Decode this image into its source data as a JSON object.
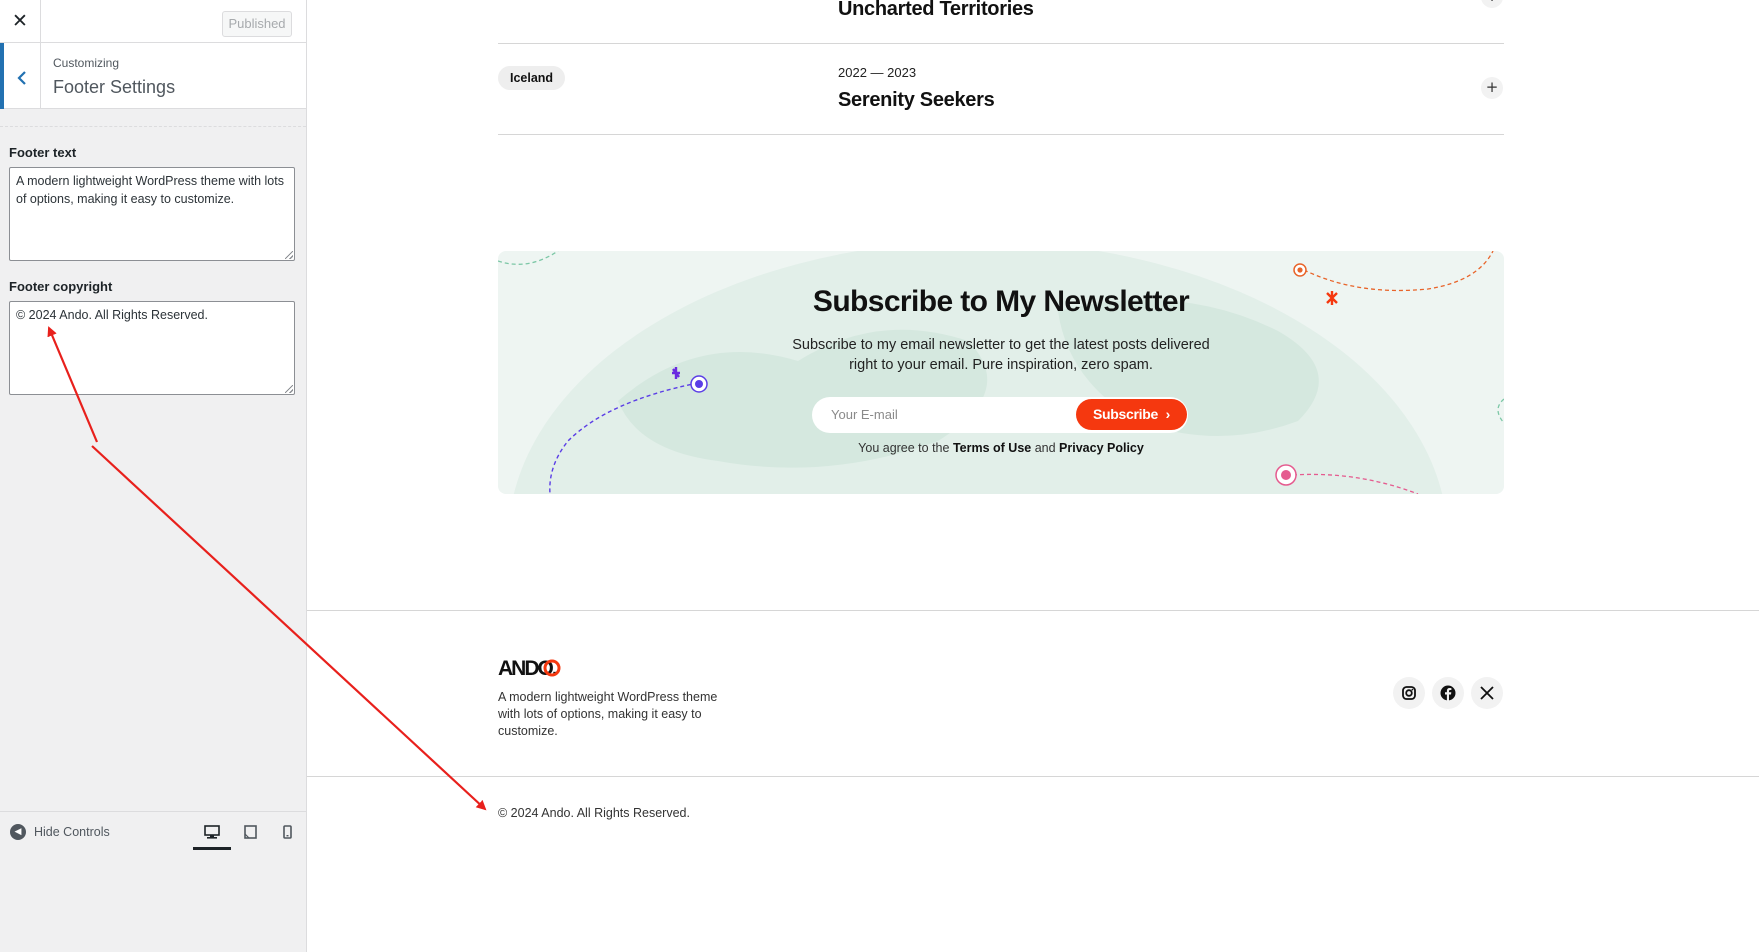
{
  "sidebar": {
    "close_symbol": "✕",
    "publish_label": "Published",
    "back_symbol": "‹",
    "customizing_label": "Customizing",
    "section_title": "Footer Settings",
    "controls": [
      {
        "label": "Footer text",
        "value": "A modern lightweight WordPress theme with lots of options, making it easy to customize."
      },
      {
        "label": "Footer copyright",
        "value": "© 2024 Ando. All Rights Reserved."
      }
    ],
    "footer": {
      "hide_controls_label": "Hide Controls",
      "devices": [
        "desktop-icon",
        "tablet-icon",
        "mobile-icon"
      ],
      "active_device": "desktop"
    }
  },
  "preview": {
    "tours": [
      {
        "title": "Uncharted Territories"
      },
      {
        "tag": "Iceland",
        "years": "2022 — 2023",
        "title": "Serenity Seekers",
        "expand_symbol": "+"
      }
    ],
    "newsletter": {
      "title": "Subscribe to My Newsletter",
      "description": "Subscribe to my email newsletter to get the latest posts delivered right to your email. Pure inspiration, zero spam.",
      "input_placeholder": "Your E-mail",
      "button_label": "Subscribe",
      "button_chevron": "›",
      "agree_prefix": "You agree to the",
      "terms_link": "Terms of Use",
      "agree_and": "and",
      "privacy_link": "Privacy Policy"
    },
    "footer": {
      "logo_text": "ANDO.",
      "description": "A modern lightweight WordPress theme with lots of options, making it easy to customize.",
      "social_icons": [
        "instagram-icon",
        "facebook-icon",
        "x-icon"
      ],
      "copyright": "© 2024 Ando. All Rights Reserved."
    }
  },
  "colors": {
    "accent_blue": "#2271b1",
    "subscribe_orange": "#f5380f",
    "newsletter_bg": "#eef5f2",
    "annotation_red": "#e8201c"
  }
}
